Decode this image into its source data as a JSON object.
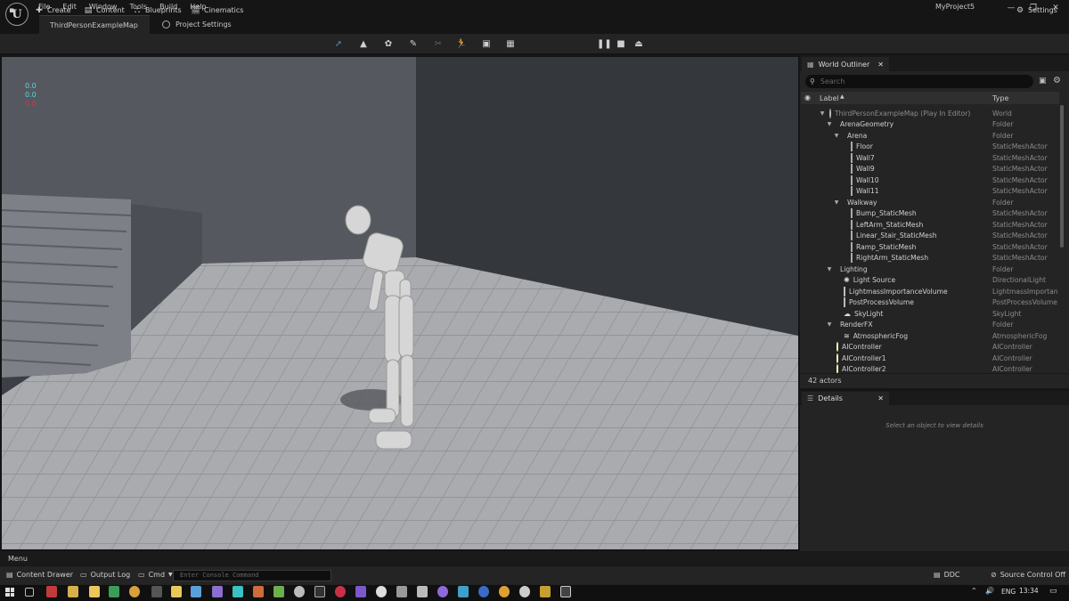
{
  "titlebar": {
    "menu": [
      "File",
      "Edit",
      "Window",
      "Tools",
      "Build",
      "Help"
    ],
    "tab_map": "ThirdPersonExampleMap",
    "tab_settings": "Project Settings",
    "project": "MyProject5"
  },
  "toolbar": {
    "create": "Create",
    "content": "Content",
    "blueprints": "Blueprints",
    "cinematics": "Cinematics",
    "settings": "Settings"
  },
  "viewport": {
    "stats": [
      "0.0",
      "0.0",
      "0.0"
    ],
    "stat_colors": [
      "#5fd3e0",
      "#5fd3e0",
      "#e0304a"
    ]
  },
  "outliner": {
    "tab": "World Outliner",
    "search_placeholder": "Search",
    "col_label": "Label",
    "col_type": "Type",
    "rows": [
      {
        "name": "ThirdPersonExampleMap (Play In Editor)",
        "type": "World",
        "icon": "world-icon",
        "indent": 0,
        "arrow": "▼"
      },
      {
        "name": "ArenaGeometry",
        "type": "Folder",
        "icon": "folder-icon",
        "indent": 1,
        "arrow": "▼"
      },
      {
        "name": "Arena",
        "type": "Folder",
        "icon": "folder-icon",
        "indent": 2,
        "arrow": "▼"
      },
      {
        "name": "Floor",
        "type": "StaticMeshActor",
        "icon": "static-mesh-icon",
        "indent": 3,
        "arrow": ""
      },
      {
        "name": "Wall7",
        "type": "StaticMeshActor",
        "icon": "static-mesh-icon",
        "indent": 3,
        "arrow": ""
      },
      {
        "name": "Wall9",
        "type": "StaticMeshActor",
        "icon": "static-mesh-icon",
        "indent": 3,
        "arrow": ""
      },
      {
        "name": "Wall10",
        "type": "StaticMeshActor",
        "icon": "static-mesh-icon",
        "indent": 3,
        "arrow": ""
      },
      {
        "name": "Wall11",
        "type": "StaticMeshActor",
        "icon": "static-mesh-icon",
        "indent": 3,
        "arrow": ""
      },
      {
        "name": "Walkway",
        "type": "Folder",
        "icon": "folder-icon",
        "indent": 2,
        "arrow": "▼"
      },
      {
        "name": "Bump_StaticMesh",
        "type": "StaticMeshActor",
        "icon": "static-mesh-icon",
        "indent": 3,
        "arrow": ""
      },
      {
        "name": "LeftArm_StaticMesh",
        "type": "StaticMeshActor",
        "icon": "static-mesh-icon",
        "indent": 3,
        "arrow": ""
      },
      {
        "name": "Linear_Stair_StaticMesh",
        "type": "StaticMeshActor",
        "icon": "static-mesh-icon",
        "indent": 3,
        "arrow": ""
      },
      {
        "name": "Ramp_StaticMesh",
        "type": "StaticMeshActor",
        "icon": "static-mesh-icon",
        "indent": 3,
        "arrow": ""
      },
      {
        "name": "RightArm_StaticMesh",
        "type": "StaticMeshActor",
        "icon": "static-mesh-icon",
        "indent": 3,
        "arrow": ""
      },
      {
        "name": "Lighting",
        "type": "Folder",
        "icon": "folder-icon",
        "indent": 1,
        "arrow": "▼"
      },
      {
        "name": "Light Source",
        "type": "DirectionalLight",
        "icon": "light-icon",
        "indent": 2,
        "arrow": ""
      },
      {
        "name": "LightmassImportanceVolume",
        "type": "LightmassImportanceVolume",
        "icon": "volume-icon",
        "indent": 2,
        "arrow": ""
      },
      {
        "name": "PostProcessVolume",
        "type": "PostProcessVolume",
        "icon": "volume-icon",
        "indent": 2,
        "arrow": ""
      },
      {
        "name": "SkyLight",
        "type": "SkyLight",
        "icon": "skylight-icon",
        "indent": 2,
        "arrow": ""
      },
      {
        "name": "RenderFX",
        "type": "Folder",
        "icon": "folder-icon",
        "indent": 1,
        "arrow": "▼"
      },
      {
        "name": "AtmosphericFog",
        "type": "AtmosphericFog",
        "icon": "fog-icon",
        "indent": 2,
        "arrow": ""
      },
      {
        "name": "AIController",
        "type": "AIController",
        "icon": "actor-icon",
        "indent": 1,
        "arrow": ""
      },
      {
        "name": "AIController1",
        "type": "AIController",
        "icon": "actor-icon",
        "indent": 1,
        "arrow": ""
      },
      {
        "name": "AIController2",
        "type": "AIController",
        "icon": "actor-icon",
        "indent": 1,
        "arrow": ""
      }
    ],
    "count": "42 actors"
  },
  "details": {
    "tab": "Details",
    "empty": "Select an object to view details"
  },
  "bottom": {
    "menu": "Menu",
    "content_drawer": "Content Drawer",
    "output_log": "Output Log",
    "cmd": "Cmd",
    "console_placeholder": "Enter Console Command",
    "ddc": "DDC",
    "source_control": "Source Control Off"
  },
  "taskbar": {
    "lang": "ENG",
    "time": "13:34"
  },
  "colors": {
    "accent": "#4d8fd8",
    "folder": "#c8a85c"
  }
}
